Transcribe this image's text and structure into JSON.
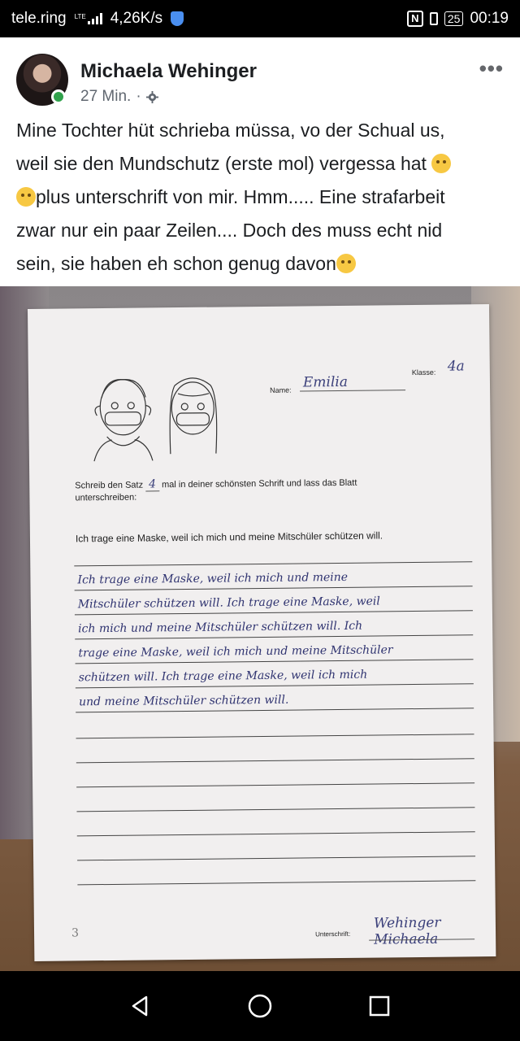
{
  "status_bar": {
    "carrier": "tele.ring",
    "network_badge": "LTE",
    "speed": "4,26K/s",
    "battery": "25",
    "time": "00:19",
    "icons": [
      "signal-icon",
      "security-shield-icon",
      "nfc-icon",
      "vibrate-icon",
      "battery-icon"
    ]
  },
  "post": {
    "author": "Michaela Wehinger",
    "time": "27 Min.",
    "separator": "·",
    "more_icon": "more-dots-icon",
    "line1": "Mine Tochter hüt schrieba müssa, vo der Schual us,",
    "line2": "weil sie den Mundschutz (erste mol) vergessa hat",
    "line3": "plus unterschrift von mir. Hmm..... Eine strafarbeit",
    "line4": "zwar nur ein paar Zeilen....  Doch des muss echt nid",
    "line5": "sein, sie haben eh schon genug davon"
  },
  "worksheet": {
    "name_label": "Name:",
    "name_value": "Emilia",
    "klasse_label": "Klasse:",
    "klasse_value": "4a",
    "instruction_pre": "Schreib den Satz",
    "instruction_count": "4",
    "instruction_post": "mal in deiner schönsten Schrift und lass das Blatt",
    "instruction_line2": "unterschreiben:",
    "sentence": "Ich trage eine Maske, weil ich mich und meine Mitschüler schützen will.",
    "handwriting": [
      "Ich trage eine Maske, weil ich mich und meine",
      "Mitschüler schützen will. Ich trage eine Maske, weil",
      "ich mich und meine Mitschüler schützen will. Ich",
      "trage eine Maske, weil ich mich und meine Mitschüler",
      "schützen will. Ich trage eine Maske, weil ich mich",
      "und meine Mitschüler schützen will."
    ],
    "signature_label": "Unterschrift:",
    "signature_value": "Wehinger Michaela",
    "page_mark": "3"
  },
  "nav_bar": {
    "icons": [
      "back-icon",
      "home-icon",
      "recents-icon"
    ]
  }
}
